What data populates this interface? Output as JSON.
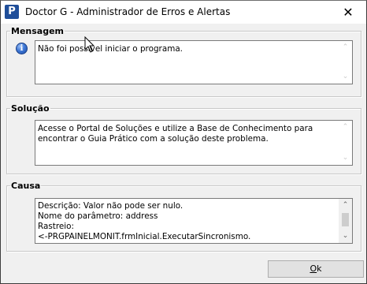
{
  "window": {
    "title": "Doctor G - Administrador de Erros e Alertas",
    "icon_letter": "P",
    "icon": "doctor-g-app-icon",
    "close_glyph": "✕"
  },
  "mensagem": {
    "legend": "Mensagem",
    "icon": "info-icon",
    "icon_glyph": "i",
    "text": "Não foi possível iniciar o programa."
  },
  "solucao": {
    "legend": "Solução",
    "text": "Acesse o Portal de Soluções e utilize a Base de Conhecimento para encontrar o Guia Prático com a solução deste problema."
  },
  "causa": {
    "legend": "Causa",
    "text": "Descrição: Valor não pode ser nulo.\nNome do parâmetro: address\nRastreio:\n<-PRGPAINELMONIT.frmInicial.ExecutarSincronismo."
  },
  "buttons": {
    "ok_label": "k",
    "ok_mnemonic": "O"
  },
  "scroll_arrows": {
    "up": "⌃",
    "down": "⌄"
  }
}
